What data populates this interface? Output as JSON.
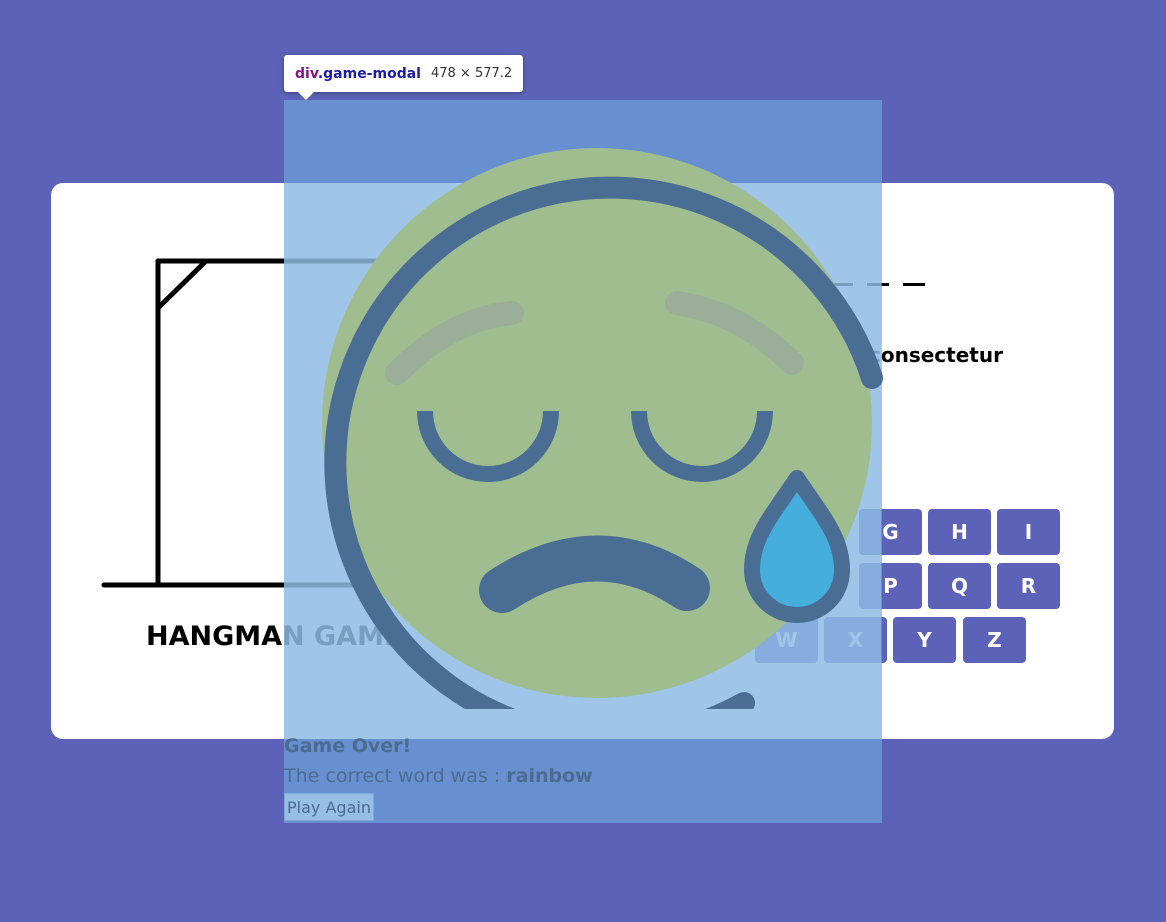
{
  "game": {
    "title": "HANGMAN GAME",
    "hint_partial": "consectetur",
    "keyboard_keys": [
      "G",
      "H",
      "I",
      "P",
      "Q",
      "R",
      "W",
      "X",
      "Y",
      "Z"
    ]
  },
  "modal": {
    "heading": "Game Over!",
    "correct_prefix": "The correct word was : ",
    "correct_word": "rainbow",
    "play_again_label": "Play Again",
    "emoji_name": "sad-face-with-sweat-icon"
  },
  "devtools": {
    "tag": "div",
    "class": ".game-modal",
    "dimensions": "478 × 577.2"
  },
  "colors": {
    "page_bg": "#5c62b8",
    "key_bg": "#5c62b8",
    "overlay": "#6fa8dc"
  }
}
